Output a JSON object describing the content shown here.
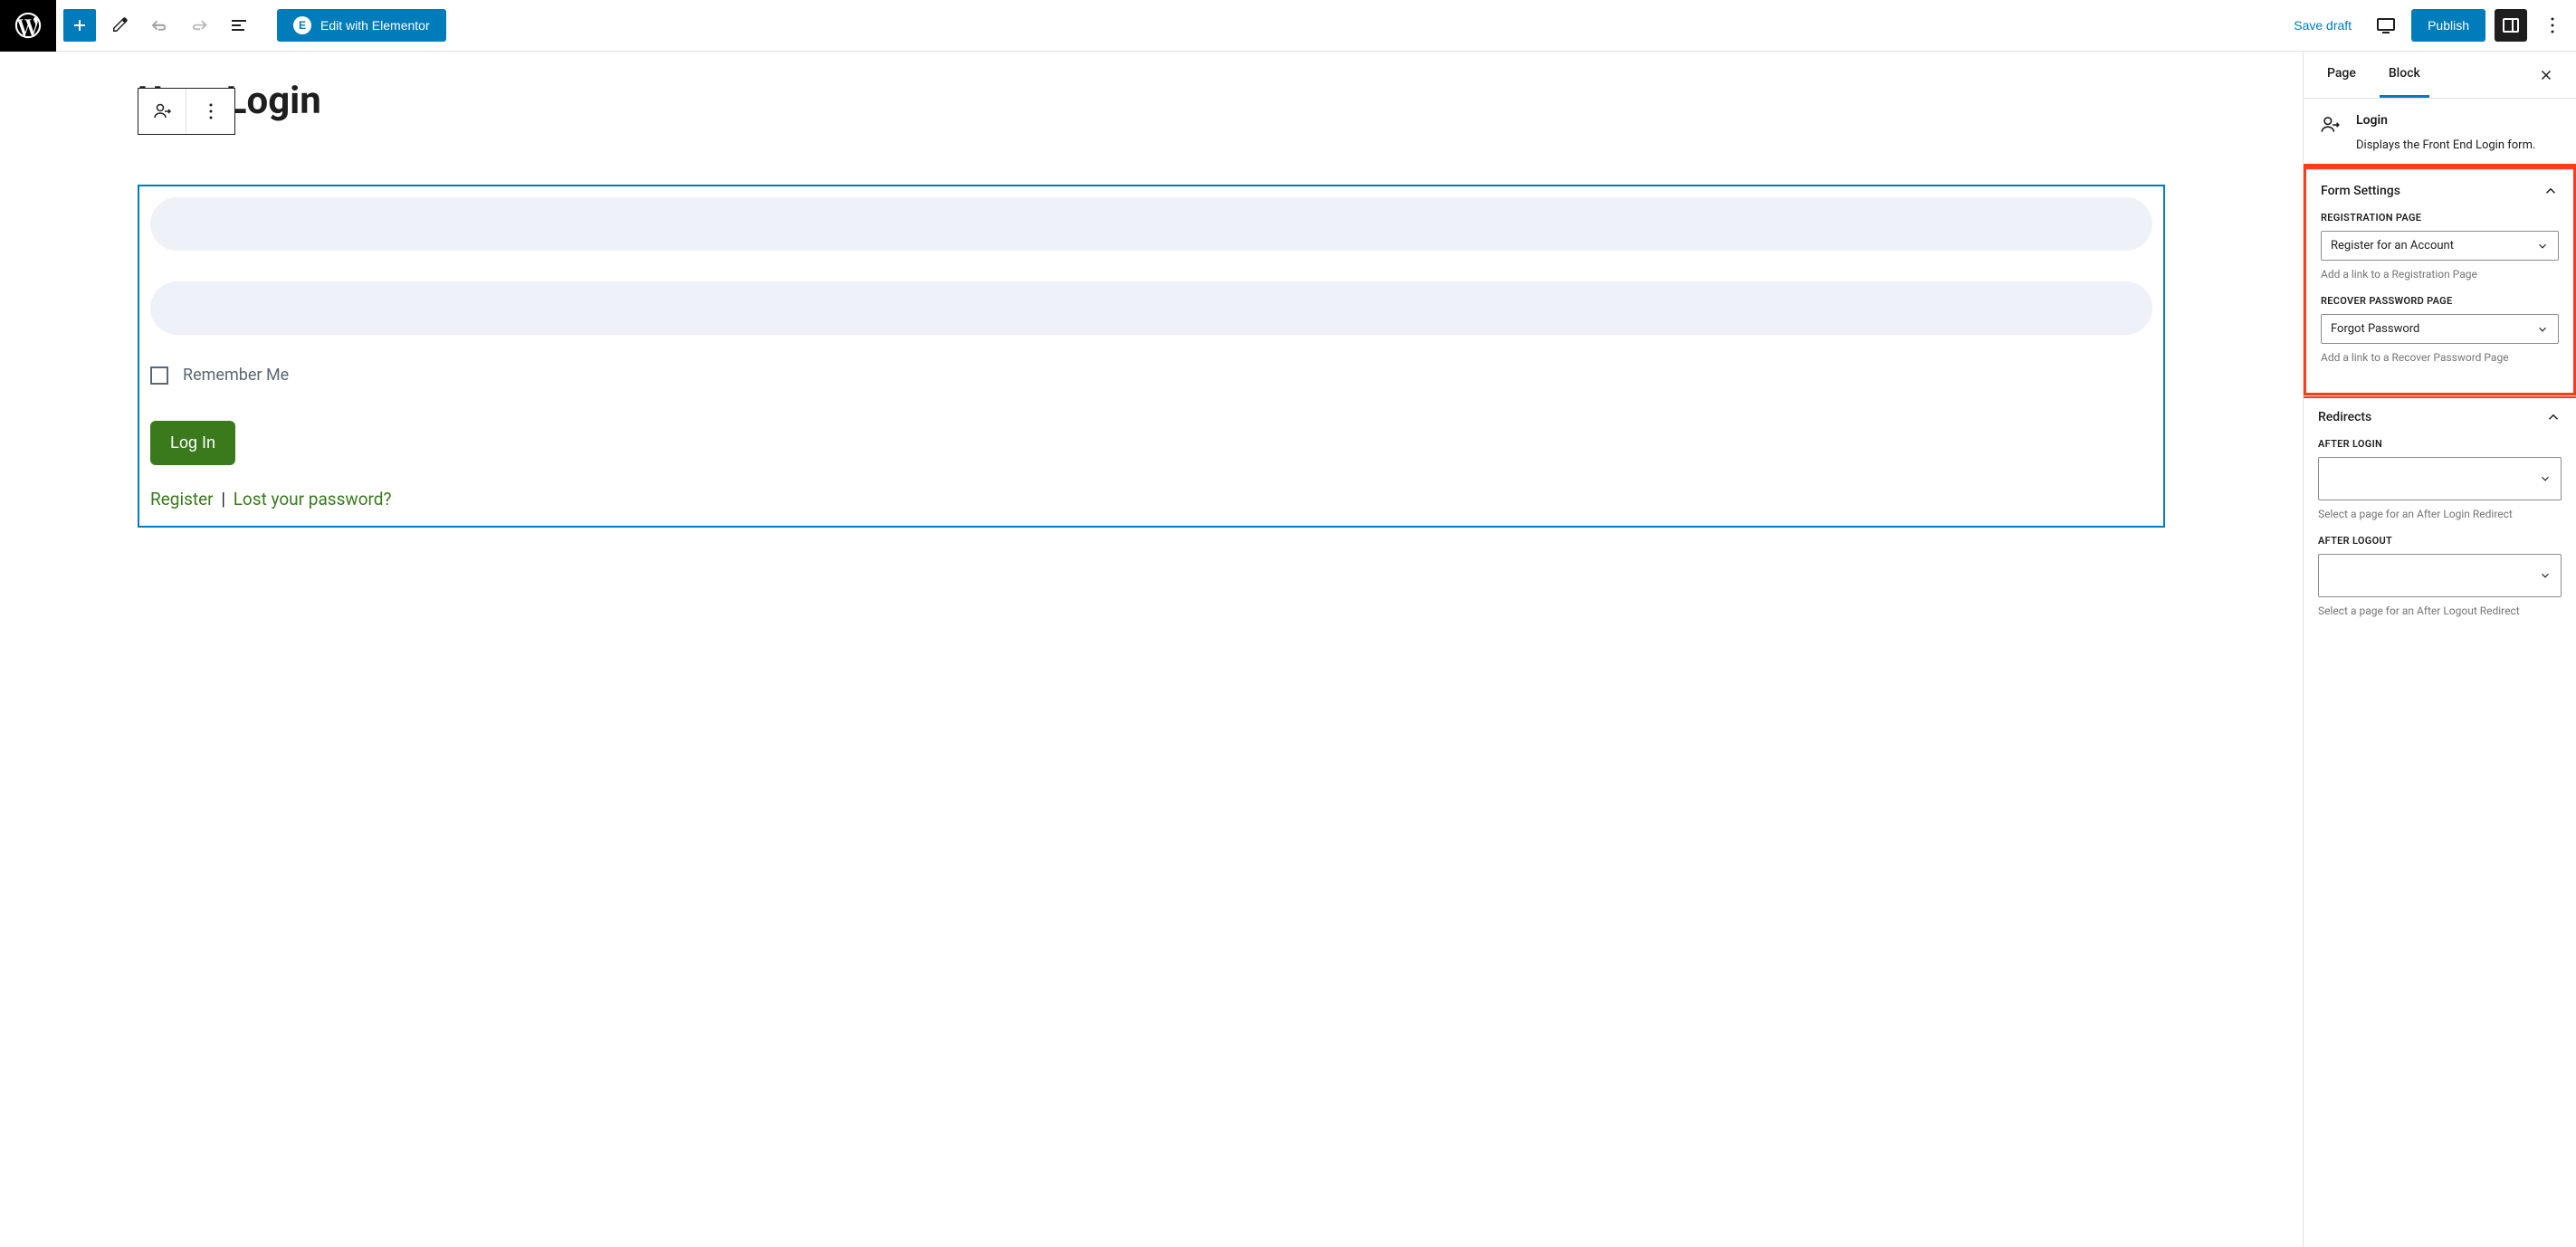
{
  "top": {
    "edit_elementor": "Edit with Elementor",
    "save_draft": "Save draft",
    "publish": "Publish"
  },
  "canvas": {
    "page_title": "User Login",
    "remember_me": "Remember Me",
    "login_button": "Log In",
    "register_link": "Register",
    "lost_password_link": "Lost your password?",
    "separator": "|"
  },
  "sidebar": {
    "tabs": {
      "page": "Page",
      "block": "Block"
    },
    "block_info": {
      "title": "Login",
      "desc": "Displays the Front End Login form."
    },
    "form_settings": {
      "title": "Form Settings",
      "registration": {
        "label": "Registration Page",
        "value": "Register for an Account",
        "help": "Add a link to a Registration Page"
      },
      "recover": {
        "label": "Recover Password Page",
        "value": "Forgot Password",
        "help": "Add a link to a Recover Password Page"
      }
    },
    "redirects": {
      "title": "Redirects",
      "after_login": {
        "label": "After Login",
        "help": "Select a page for an After Login Redirect"
      },
      "after_logout": {
        "label": "After Logout",
        "help": "Select a page for an After Logout Redirect"
      }
    }
  }
}
